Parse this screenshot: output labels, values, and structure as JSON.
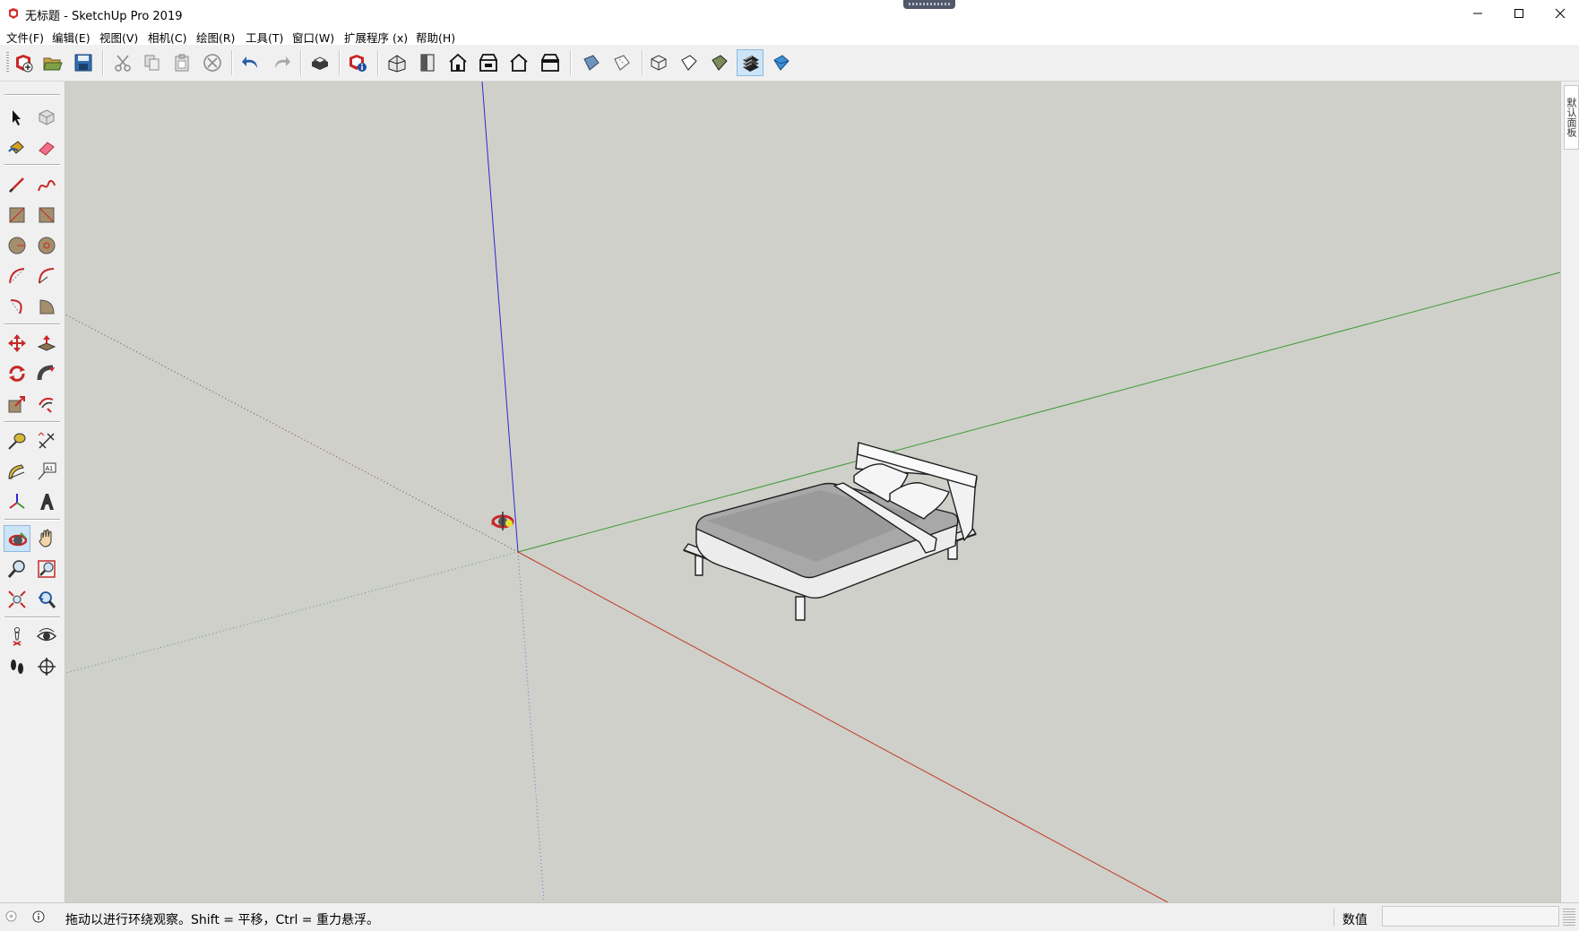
{
  "window": {
    "title": "无标题 - SketchUp Pro 2019",
    "app_icon": "sketchup-icon",
    "controls": [
      "minimize-icon",
      "maximize-icon",
      "close-icon"
    ]
  },
  "menu": [
    {
      "label": "文件(F)"
    },
    {
      "label": "编辑(E)"
    },
    {
      "label": "视图(V)"
    },
    {
      "label": "相机(C)"
    },
    {
      "label": "绘图(R)"
    },
    {
      "label": "工具(T)"
    },
    {
      "label": "窗口(W)"
    },
    {
      "label": "扩展程序 (x)"
    },
    {
      "label": "帮助(H)"
    }
  ],
  "toolbar": {
    "groups": [
      [
        "new-icon",
        "open-icon",
        "save-icon"
      ],
      [
        "cut-icon",
        "copy-icon",
        "paste-icon",
        "erase-icon"
      ],
      [
        "undo-icon",
        "redo-icon"
      ],
      [
        "print-icon"
      ],
      [
        "model-info-icon"
      ],
      [
        "iso-view-icon",
        "top-view-icon",
        "front-view-icon",
        "right-view-icon",
        "back-view-icon",
        "left-view-icon"
      ],
      [
        "xray-icon",
        "back-edges-icon"
      ],
      [
        "wireframe-icon",
        "hidden-line-icon",
        "shaded-icon",
        "shaded-textures-icon",
        "monochrome-icon"
      ]
    ],
    "active": "shaded-textures-icon"
  },
  "palette": {
    "tools": [
      "select-icon",
      "make-component-icon",
      "paint-bucket-icon",
      "eraser-icon",
      "line-icon",
      "freehand-icon",
      "rectangle-icon",
      "rotated-rectangle-icon",
      "circle-icon",
      "polygon-icon",
      "arc-icon",
      "two-point-arc-icon",
      "three-point-arc-icon",
      "pie-icon",
      "move-icon",
      "push-pull-icon",
      "rotate-icon",
      "follow-me-icon",
      "scale-icon",
      "offset-icon",
      "tape-measure-icon",
      "dimension-icon",
      "protractor-icon",
      "text-icon",
      "axes-icon",
      "3d-text-icon",
      "orbit-icon",
      "pan-icon",
      "zoom-icon",
      "zoom-window-icon",
      "zoom-extents-icon",
      "previous-view-icon",
      "position-camera-icon",
      "look-around-icon",
      "walk-icon",
      "section-plane-icon"
    ],
    "active": "orbit-icon"
  },
  "tray": {
    "tab_label": "默认面板"
  },
  "status": {
    "message": "拖动以进行环绕观察。Shift = 平移，Ctrl = 重力悬浮。",
    "measurements_label": "数值",
    "measurements_value": ""
  },
  "colors": {
    "viewport_bg": "#cfd0c9",
    "axis_red": "#c0392b",
    "axis_green": "#3c9a34",
    "axis_blue": "#2b2bd0",
    "active_button": "#cce4f7"
  }
}
